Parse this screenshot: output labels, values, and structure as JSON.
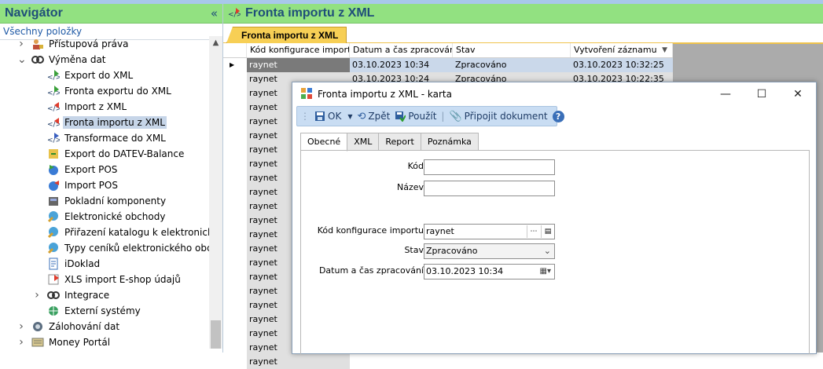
{
  "navigator": {
    "title": "Navigátor",
    "collapse_glyph": "«",
    "subtitle": "Všechny položky",
    "items": [
      {
        "label": "Přístupová práva",
        "level": 1,
        "expander": "collapsed",
        "icon": "user-lock-icon"
      },
      {
        "label": "Výměna dat",
        "level": 1,
        "expander": "expanded",
        "icon": "data-exchange-icon"
      },
      {
        "label": "Export do XML",
        "level": 2,
        "icon": "xml-export-icon"
      },
      {
        "label": "Fronta exportu do XML",
        "level": 2,
        "icon": "xml-export-queue-icon"
      },
      {
        "label": "Import z XML",
        "level": 2,
        "icon": "xml-import-icon"
      },
      {
        "label": "Fronta importu z XML",
        "level": 2,
        "icon": "xml-import-queue-icon",
        "selected": true
      },
      {
        "label": "Transformace do XML",
        "level": 2,
        "icon": "xml-transform-icon"
      },
      {
        "label": "Export do DATEV-Balance",
        "level": 2,
        "icon": "datev-export-icon"
      },
      {
        "label": "Export POS",
        "level": 2,
        "icon": "pos-export-icon"
      },
      {
        "label": "Import POS",
        "level": 2,
        "icon": "pos-import-icon"
      },
      {
        "label": "Pokladní komponenty",
        "level": 2,
        "icon": "cash-register-icon"
      },
      {
        "label": "Elektronické obchody",
        "level": 2,
        "icon": "e-shop-icon"
      },
      {
        "label": "Přiřazení katalogu k elektronickému",
        "level": 2,
        "icon": "catalog-assign-icon"
      },
      {
        "label": "Typy ceníků elektronického obchodu",
        "level": 2,
        "icon": "price-list-icon"
      },
      {
        "label": "iDoklad",
        "level": 2,
        "icon": "idoklad-icon"
      },
      {
        "label": "XLS import E-shop údajů",
        "level": 2,
        "icon": "xls-import-icon"
      },
      {
        "label": "Integrace",
        "level": 2,
        "expander": "collapsed",
        "icon": "integration-icon"
      },
      {
        "label": "Externí systémy",
        "level": 2,
        "icon": "external-systems-icon"
      },
      {
        "label": "Zálohování dat",
        "level": 1,
        "expander": "collapsed",
        "icon": "backup-icon"
      },
      {
        "label": "Money Portál",
        "level": 1,
        "expander": "collapsed",
        "icon": "money-portal-icon"
      }
    ]
  },
  "main": {
    "title": "Fronta importu z XML",
    "doc_tab": "Fronta importu z XML",
    "grid": {
      "columns": [
        "Kód konfigurace importu",
        "Datum a čas zpracování",
        "Stav",
        "Vytvoření záznamu"
      ],
      "rows": [
        [
          "raynet",
          "03.10.2023 10:34",
          "Zpracováno",
          "03.10.2023 10:32:25"
        ],
        [
          "raynet",
          "03.10.2023 10:24",
          "Zpracováno",
          "03.10.2023 10:22:35"
        ],
        [
          "raynet"
        ],
        [
          "raynet"
        ],
        [
          "raynet"
        ],
        [
          "raynet"
        ],
        [
          "raynet"
        ],
        [
          "raynet"
        ],
        [
          "raynet"
        ],
        [
          "raynet"
        ],
        [
          "raynet"
        ],
        [
          "raynet"
        ],
        [
          "raynet"
        ],
        [
          "raynet"
        ],
        [
          "raynet"
        ],
        [
          "raynet"
        ],
        [
          "raynet"
        ],
        [
          "raynet"
        ],
        [
          "raynet"
        ],
        [
          "raynet"
        ],
        [
          "raynet"
        ],
        [
          "raynet"
        ]
      ]
    }
  },
  "dialog": {
    "title": "Fronta importu z XML - karta",
    "toolbar": {
      "ok": "OK",
      "back": "Zpět",
      "apply": "Použít",
      "attach": "Připojit dokument"
    },
    "tabs": [
      "Obecné",
      "XML",
      "Report",
      "Poznámka"
    ],
    "fields": {
      "kod_label": "Kód",
      "kod_value": "",
      "nazev_label": "Název",
      "nazev_value": "",
      "konfig_label": "Kód konfigurace importu",
      "konfig_value": "raynet",
      "stav_label": "Stav",
      "stav_value": "Zpracováno",
      "datum_label": "Datum a čas zpracování",
      "datum_value": "03.10.2023 10:34"
    }
  },
  "colors": {
    "header_green": "#92e181",
    "title_blue": "#1f4e79",
    "tab_yellow": "#f7cf55",
    "toolbar_blue": "#c9ddf3"
  }
}
